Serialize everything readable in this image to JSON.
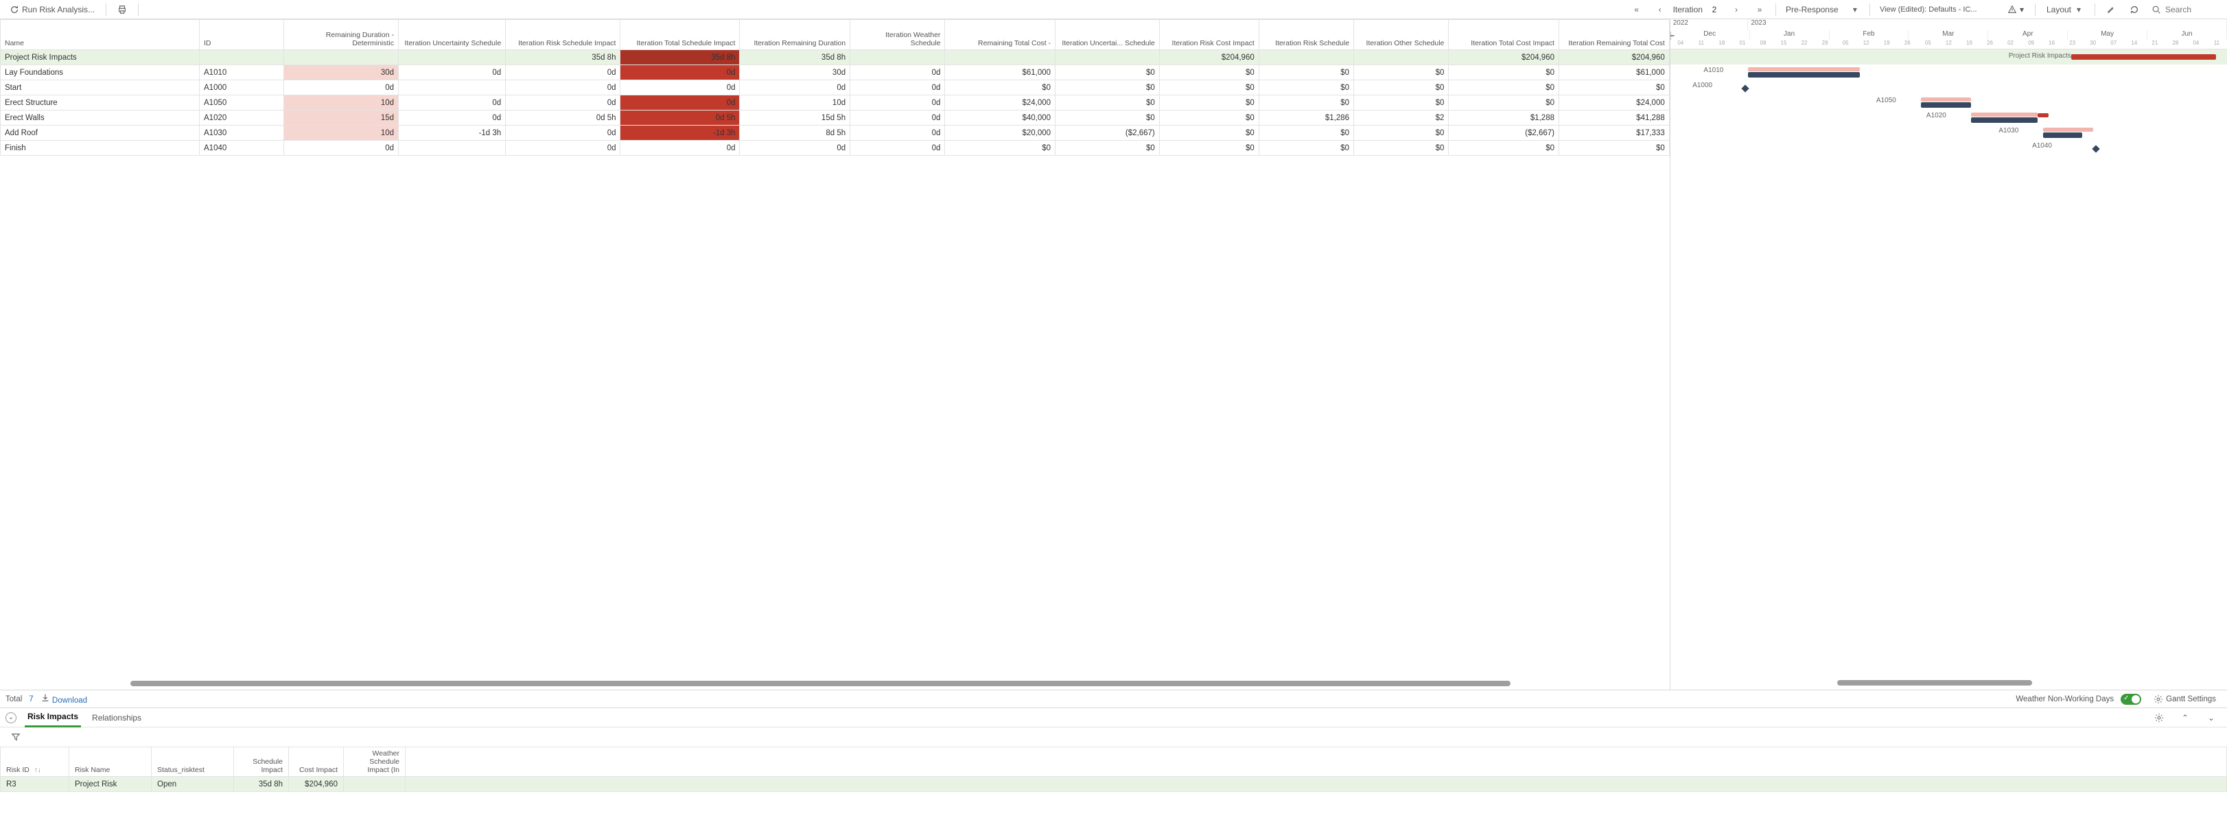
{
  "toolbar": {
    "run_label": "Run Risk Analysis...",
    "iteration_label": "Iteration",
    "iteration_value": "2",
    "scenario": "Pre-Response",
    "view_label": "View (Edited): Defaults - IC...",
    "layout_label": "Layout",
    "search_placeholder": "Search"
  },
  "grid": {
    "columns": [
      "Name",
      "ID",
      "Remaining Duration - Deterministic",
      "Iteration Uncertainty Schedule",
      "Iteration Risk Schedule Impact",
      "Iteration Total Schedule Impact",
      "Iteration Remaining Duration",
      "Iteration Weather Schedule",
      "Remaining Total Cost -",
      "Iteration Uncertai... Schedule",
      "Iteration Risk Cost Impact",
      "Iteration Risk Schedule",
      "Iteration Other Schedule",
      "Iteration Total Cost Impact",
      "Iteration Remaining Total Cost"
    ],
    "rows": [
      {
        "summary": true,
        "name": "Project Risk Impacts",
        "id": "",
        "c2": "",
        "c3": "",
        "c4": "35d 8h",
        "c5": "35d 8h",
        "c6": "35d 8h",
        "c7": "",
        "c8": "",
        "c9": "",
        "c10": "$204,960",
        "c11": "",
        "c12": "",
        "c13": "$204,960",
        "c14": "$204,960",
        "hl4": "",
        "hl5": "red-dark"
      },
      {
        "name": "Lay Foundations",
        "id": "A1010",
        "c2": "30d",
        "c3": "0d",
        "c4": "0d",
        "c5": "0d",
        "c6": "30d",
        "c7": "0d",
        "c8": "$61,000",
        "c9": "$0",
        "c10": "$0",
        "c11": "$0",
        "c12": "$0",
        "c13": "$0",
        "c14": "$61,000",
        "hl2": "pink",
        "hl5": "red"
      },
      {
        "name": "Start",
        "id": "A1000",
        "c2": "0d",
        "c3": "",
        "c4": "0d",
        "c5": "0d",
        "c6": "0d",
        "c7": "0d",
        "c8": "$0",
        "c9": "$0",
        "c10": "$0",
        "c11": "$0",
        "c12": "$0",
        "c13": "$0",
        "c14": "$0"
      },
      {
        "name": "Erect Structure",
        "id": "A1050",
        "c2": "10d",
        "c3": "0d",
        "c4": "0d",
        "c5": "0d",
        "c6": "10d",
        "c7": "0d",
        "c8": "$24,000",
        "c9": "$0",
        "c10": "$0",
        "c11": "$0",
        "c12": "$0",
        "c13": "$0",
        "c14": "$24,000",
        "hl2": "pink",
        "hl5": "red"
      },
      {
        "name": "Erect Walls",
        "id": "A1020",
        "c2": "15d",
        "c3": "0d",
        "c4": "0d 5h",
        "c5": "0d 5h",
        "c6": "15d 5h",
        "c7": "0d",
        "c8": "$40,000",
        "c9": "$0",
        "c10": "$0",
        "c11": "$1,286",
        "c12": "$2",
        "c13": "$1,288",
        "c14": "$41,288",
        "hl2": "pink",
        "hl5": "red"
      },
      {
        "name": "Add Roof",
        "id": "A1030",
        "c2": "10d",
        "c3": "-1d 3h",
        "c4": "0d",
        "c5": "-1d 3h",
        "c6": "8d 5h",
        "c7": "0d",
        "c8": "$20,000",
        "c9": "($2,667)",
        "c10": "$0",
        "c11": "$0",
        "c12": "$0",
        "c13": "($2,667)",
        "c14": "$17,333",
        "hl2": "pink",
        "hl5": "red"
      },
      {
        "name": "Finish",
        "id": "A1040",
        "c2": "0d",
        "c3": "",
        "c4": "0d",
        "c5": "0d",
        "c6": "0d",
        "c7": "0d",
        "c8": "$0",
        "c9": "$0",
        "c10": "$0",
        "c11": "$0",
        "c12": "$0",
        "c13": "$0",
        "c14": "$0"
      }
    ]
  },
  "gantt": {
    "years": [
      "2022",
      "2023"
    ],
    "months": [
      "Dec",
      "Jan",
      "Feb",
      "Mar",
      "Apr",
      "May",
      "Jun"
    ],
    "days": [
      "04",
      "11",
      "18",
      "01",
      "08",
      "15",
      "22",
      "29",
      "05",
      "12",
      "19",
      "26",
      "05",
      "12",
      "19",
      "26",
      "02",
      "09",
      "16",
      "23",
      "30",
      "07",
      "14",
      "21",
      "28",
      "04",
      "11"
    ],
    "summary_label": "Project Risk Impacts",
    "labels": [
      "A1010",
      "A1000",
      "A1050",
      "A1020",
      "A1030",
      "A1040"
    ]
  },
  "strip": {
    "total_label": "Total",
    "total_value": "7",
    "download_label": "Download",
    "weather_label": "Weather Non-Working Days",
    "gantt_settings_label": "Gantt Settings"
  },
  "detail": {
    "tabs": [
      "Risk Impacts",
      "Relationships"
    ],
    "columns": [
      "Risk ID",
      "Risk Name",
      "Status_risktest",
      "Schedule Impact",
      "Cost Impact",
      "Weather Schedule Impact (In"
    ],
    "row": {
      "risk_id": "R3",
      "risk_name": "Project Risk",
      "status": "Open",
      "schedule_impact": "35d 8h",
      "cost_impact": "$204,960",
      "weather": ""
    }
  }
}
